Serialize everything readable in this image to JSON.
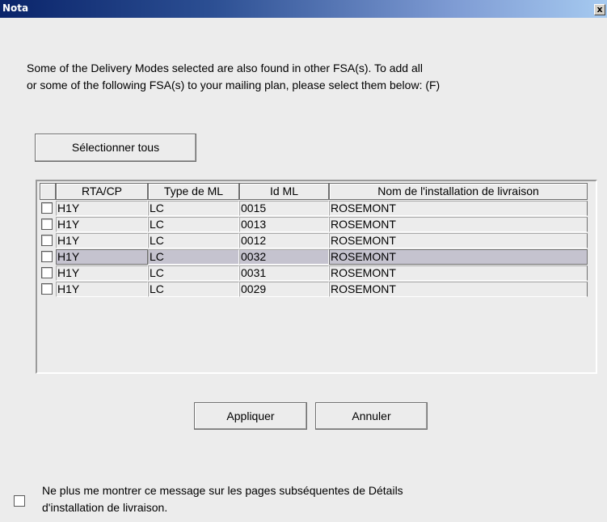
{
  "window": {
    "title": "Nota",
    "close_label": "x"
  },
  "message": {
    "line1": "Some of the Delivery Modes selected are also found in other FSA(s). To add all",
    "line2": "or some of the following FSA(s) to your mailing plan, please select them below: (F)"
  },
  "buttons": {
    "select_all": "Sélectionner tous",
    "apply": "Appliquer",
    "cancel": "Annuler"
  },
  "table": {
    "headers": [
      "",
      "RTA/CP",
      "Type de ML",
      "Id ML",
      "Nom de l'installation de livraison"
    ],
    "rows": [
      {
        "checked": false,
        "rta": "H1Y",
        "type": "LC",
        "id": "0015",
        "name": "ROSEMONT",
        "selected": false
      },
      {
        "checked": false,
        "rta": "H1Y",
        "type": "LC",
        "id": "0013",
        "name": "ROSEMONT",
        "selected": false
      },
      {
        "checked": false,
        "rta": "H1Y",
        "type": "LC",
        "id": "0012",
        "name": "ROSEMONT",
        "selected": false
      },
      {
        "checked": false,
        "rta": "H1Y",
        "type": "LC",
        "id": "0032",
        "name": "ROSEMONT",
        "selected": true
      },
      {
        "checked": false,
        "rta": "H1Y",
        "type": "LC",
        "id": "0031",
        "name": "ROSEMONT",
        "selected": false
      },
      {
        "checked": false,
        "rta": "H1Y",
        "type": "LC",
        "id": "0029",
        "name": "ROSEMONT",
        "selected": false
      }
    ]
  },
  "footer": {
    "checked": false,
    "line1": "Ne plus me montrer ce message sur les pages subséquentes de Détails",
    "line2": "d'installation de livraison."
  },
  "colors": {
    "titlebar_start": "#0a246a",
    "titlebar_end": "#a6caf0",
    "selected_row": "#c5c3cf"
  }
}
